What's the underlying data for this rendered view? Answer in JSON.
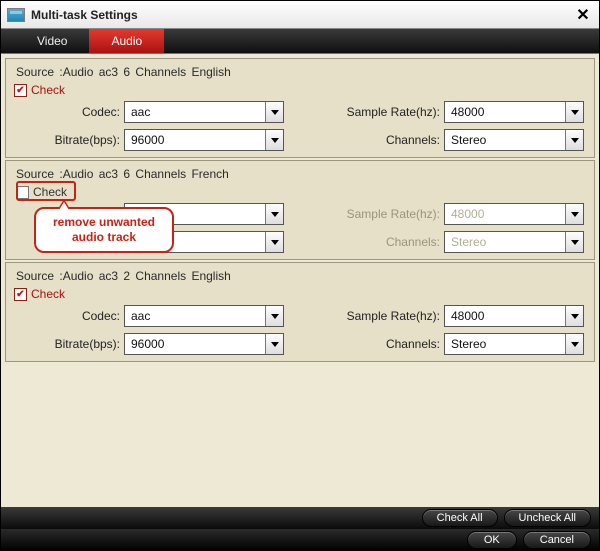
{
  "window": {
    "title": "Multi-task Settings"
  },
  "tabs": {
    "video": "Video",
    "audio": "Audio",
    "active": "audio"
  },
  "labels": {
    "check": "Check",
    "codec": "Codec:",
    "bitrate": "Bitrate(bps):",
    "samplerate": "Sample Rate(hz):",
    "channels": "Channels:"
  },
  "tracks": [
    {
      "source": "Source :Audio  ac3  6 Channels  English",
      "checked": true,
      "enabled": true,
      "codec": "aac",
      "bitrate": "96000",
      "samplerate": "48000",
      "channels": "Stereo"
    },
    {
      "source": "Source :Audio  ac3  6 Channels  French",
      "checked": false,
      "enabled": false,
      "codec": "",
      "bitrate": "",
      "samplerate": "48000",
      "channels": "Stereo"
    },
    {
      "source": "Source :Audio  ac3  2 Channels  English",
      "checked": true,
      "enabled": true,
      "codec": "aac",
      "bitrate": "96000",
      "samplerate": "48000",
      "channels": "Stereo"
    }
  ],
  "callout": "remove unwanted audio track",
  "buttons": {
    "check_all": "Check All",
    "uncheck_all": "Uncheck All",
    "ok": "OK",
    "cancel": "Cancel"
  }
}
